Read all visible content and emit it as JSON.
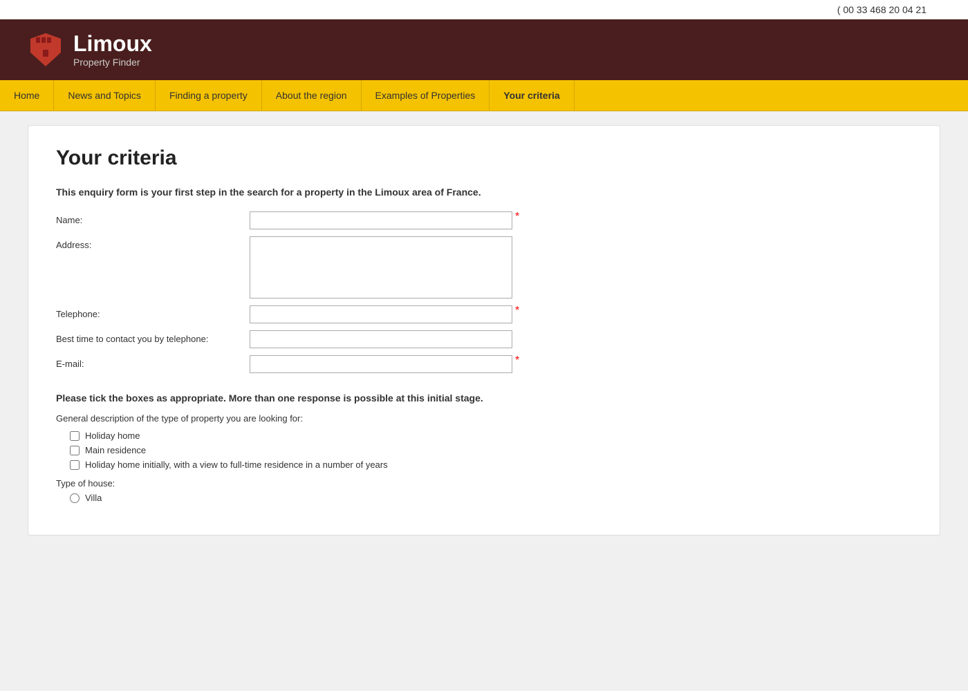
{
  "topbar": {
    "phone": "( 00 33 468 20 04 21"
  },
  "header": {
    "brand_name": "Limoux",
    "brand_subtitle": "Property Finder",
    "logo_icon": "shield"
  },
  "nav": {
    "items": [
      {
        "label": "Home",
        "active": false
      },
      {
        "label": "News and Topics",
        "active": false
      },
      {
        "label": "Finding a property",
        "active": false
      },
      {
        "label": "About the region",
        "active": false
      },
      {
        "label": "Examples of Properties",
        "active": false
      },
      {
        "label": "Your criteria",
        "active": true
      }
    ]
  },
  "page": {
    "title": "Your criteria",
    "intro": "This enquiry form is your first step in the search for a property in the Limoux area of France.",
    "form": {
      "fields": [
        {
          "label": "Name:",
          "type": "text",
          "required": true
        },
        {
          "label": "Address:",
          "type": "textarea",
          "required": false
        },
        {
          "label": "Telephone:",
          "type": "text",
          "required": true
        },
        {
          "label": "Best time to contact you by telephone:",
          "type": "text",
          "required": false
        },
        {
          "label": "E-mail:",
          "type": "text",
          "required": true
        }
      ]
    },
    "section2_title": "Please tick the boxes as appropriate. More than one response is possible at this initial stage.",
    "property_type_desc": "General description of the type of property you are looking for:",
    "checkboxes": [
      {
        "label": "Holiday home"
      },
      {
        "label": "Main residence"
      },
      {
        "label": "Holiday home initially, with a view to full-time residence in a number of years"
      }
    ],
    "house_type_label": "Type of house:",
    "radios": [
      {
        "label": "Villa"
      }
    ]
  }
}
